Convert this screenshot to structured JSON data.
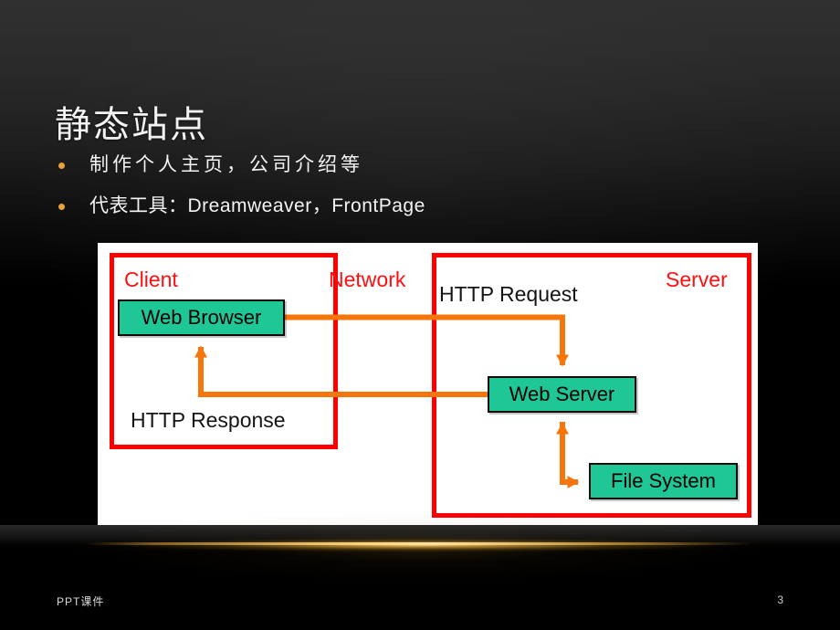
{
  "slide": {
    "title": "静态站点",
    "page_number": "3",
    "footer_label": "PPT课件",
    "background": {
      "top_gray": "#303030",
      "bottom_black": "#000000",
      "accent_glow": "#e8a33d"
    }
  },
  "bullets": [
    {
      "marker": "•",
      "text": "制作个人主页，公司介绍等"
    },
    {
      "marker": "•",
      "text": "代表工具：Dreamweaver，FrontPage"
    }
  ],
  "diagram": {
    "panel_background": "#ffffff",
    "zone_border_color": "#fd0000",
    "node_fill_color": "#1ec795",
    "wire_color": "#f7760b",
    "zones": [
      {
        "id": "client",
        "label": "Client"
      },
      {
        "id": "network",
        "label": "Network"
      },
      {
        "id": "server",
        "label": "Server"
      }
    ],
    "flow_labels": [
      {
        "id": "http-request",
        "label": "HTTP Request"
      },
      {
        "id": "http-response",
        "label": "HTTP Response"
      }
    ],
    "nodes": [
      {
        "id": "web-browser",
        "label": "Web Browser"
      },
      {
        "id": "web-server",
        "label": "Web Server"
      },
      {
        "id": "file-system",
        "label": "File System"
      }
    ],
    "connections": [
      {
        "from": "web-browser",
        "to": "web-server",
        "label": "HTTP Request"
      },
      {
        "from": "web-server",
        "to": "web-browser",
        "label": "HTTP Response"
      },
      {
        "from": "file-system",
        "to": "web-server",
        "label": ""
      },
      {
        "from": "web-server",
        "to": "file-system",
        "label": ""
      }
    ]
  }
}
